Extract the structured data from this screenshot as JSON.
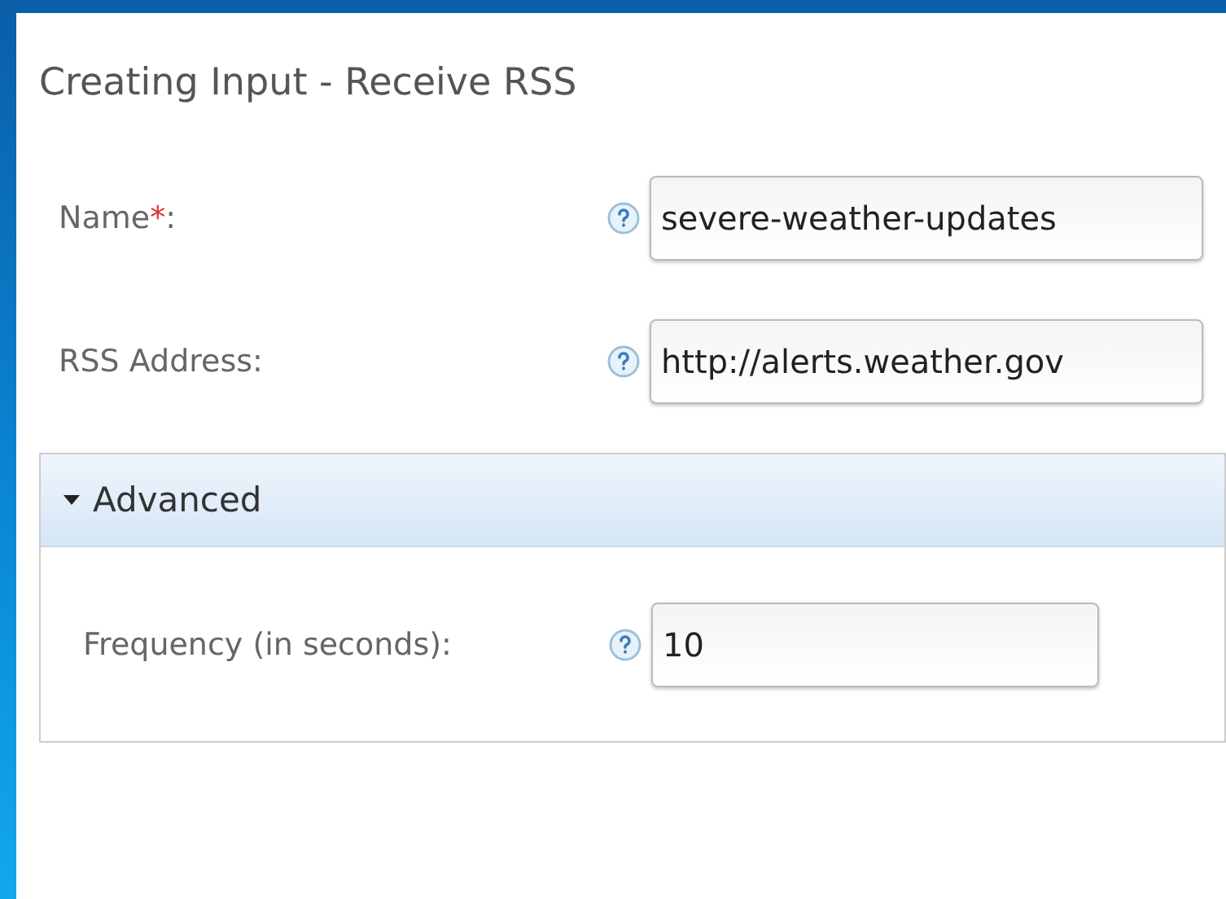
{
  "title": "Creating Input - Receive RSS",
  "fields": [
    {
      "label": "Name",
      "required_mark": "*",
      "suffix": ":",
      "value": "severe-weather-updates"
    },
    {
      "label": "RSS Address:",
      "value": "http://alerts.weather.gov"
    }
  ],
  "advanced": {
    "label": "Advanced",
    "expanded": true,
    "fields": [
      {
        "label": "Frequency (in seconds):",
        "value": "10"
      }
    ]
  }
}
